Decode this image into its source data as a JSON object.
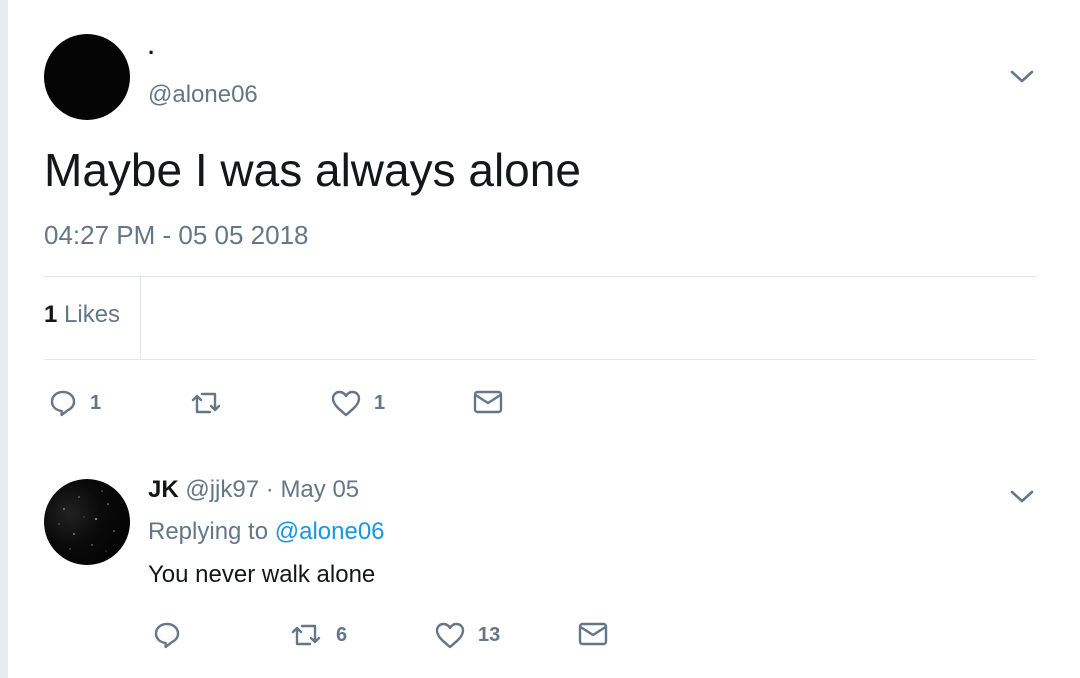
{
  "tweet": {
    "display_name": "·",
    "handle": "@alone06",
    "text": "Maybe I was always alone",
    "timestamp": "04:27 PM - 05 05 2018",
    "stats": {
      "likes_count": "1",
      "likes_label": "Likes"
    },
    "actions": {
      "reply_count": "1",
      "retweet_count": "",
      "like_count": "1"
    }
  },
  "reply": {
    "display_name": "JK",
    "handle": "@jjk97",
    "separator": "·",
    "date": "May 05",
    "replying_prefix": "Replying to",
    "replying_to": "@alone06",
    "text": "You never walk alone",
    "actions": {
      "reply_count": "",
      "retweet_count": "6",
      "like_count": "13"
    }
  },
  "icons": {
    "reply": "reply-bubble-icon",
    "retweet": "retweet-icon",
    "like": "heart-icon",
    "message": "envelope-icon",
    "menu": "chevron-down-icon"
  },
  "colors": {
    "text": "#14171a",
    "secondary": "#657786",
    "link": "#1b95e0",
    "divider": "#e1e8ed"
  }
}
